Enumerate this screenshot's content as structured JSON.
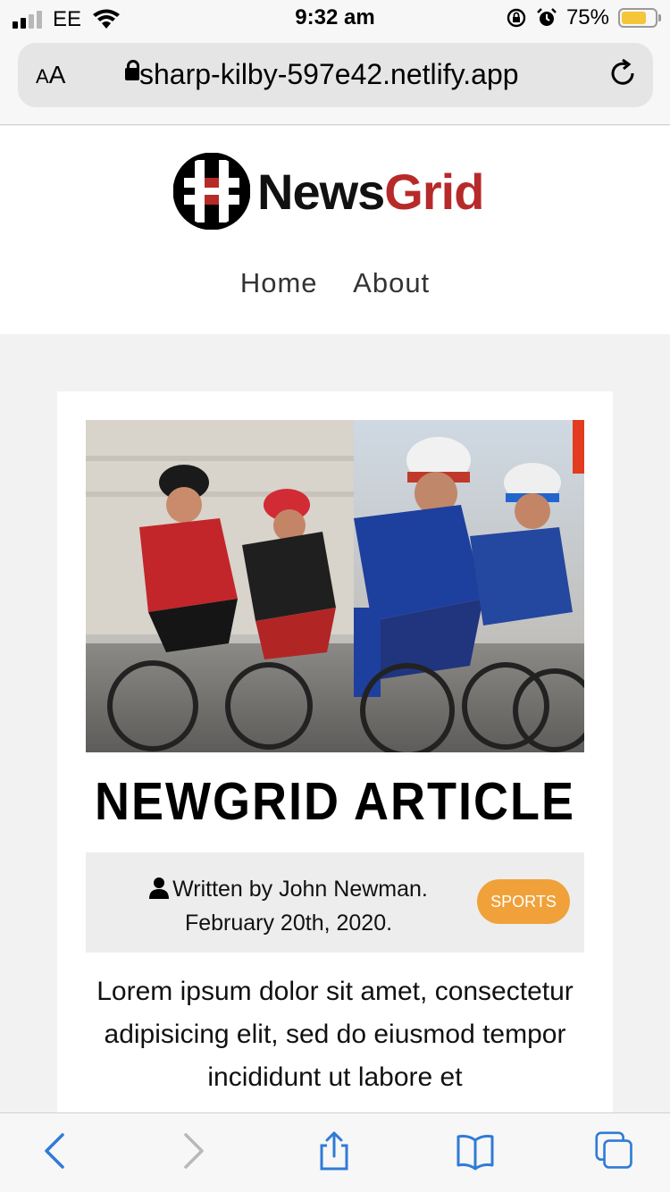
{
  "status_bar": {
    "carrier": "EE",
    "time": "9:32 am",
    "battery_percent": "75%",
    "battery_level": 0.75,
    "icons": [
      "signal-icon",
      "wifi-icon",
      "rotation-lock-icon",
      "alarm-icon",
      "battery-icon"
    ]
  },
  "browser": {
    "text_size_label_small": "A",
    "text_size_label_large": "A",
    "url": "sharp-kilby-597e42.netlify.app",
    "accent_color": "#2f7bd6"
  },
  "site": {
    "brand_part1": "News",
    "brand_part2": "Grid",
    "brand_color": "#b72a2a",
    "nav": [
      "Home",
      "About"
    ]
  },
  "article": {
    "image_alt": "cyclists-racing",
    "title": "NEWGRID ARTICLE",
    "byline": "Written by John Newman.",
    "date": "February 20th, 2020.",
    "category": "SPORTS",
    "category_color": "#f0a13a",
    "body": "Lorem ipsum dolor sit amet, consectetur adipisicing elit, sed do eiusmod tempor incididunt ut labore et"
  },
  "toolbar": {
    "icons": [
      "back-icon",
      "forward-icon",
      "share-icon",
      "bookmarks-icon",
      "tabs-icon"
    ]
  }
}
